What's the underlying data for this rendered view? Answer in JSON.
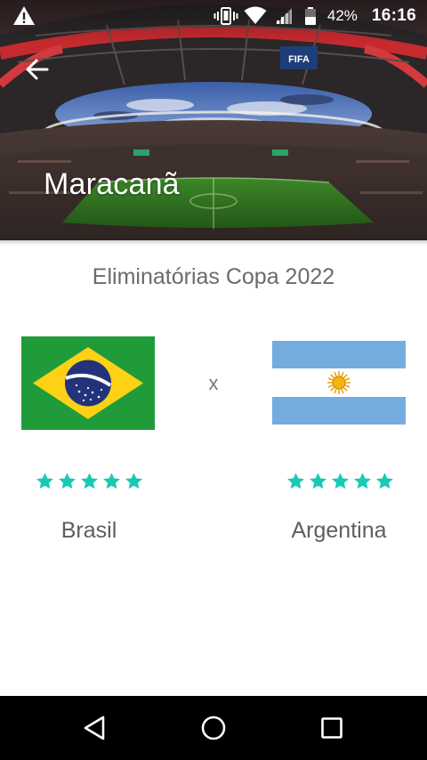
{
  "status_bar": {
    "battery_percent": "42%",
    "time": "16:16",
    "icons": [
      "warning-icon",
      "vibrate-icon",
      "wifi-icon",
      "signal-icon",
      "battery-icon"
    ]
  },
  "header": {
    "title": "Maracanã",
    "back_icon": "arrow-left-icon"
  },
  "match": {
    "competition": "Eliminatórias Copa 2022",
    "versus": "x",
    "home": {
      "name": "Brasil",
      "flag": "brazil-flag",
      "rating": 5,
      "rating_max": 5
    },
    "away": {
      "name": "Argentina",
      "flag": "argentina-flag",
      "rating": 5,
      "rating_max": 5
    }
  },
  "colors": {
    "star": "#19c9b4",
    "title": "#ffffff",
    "text_secondary": "#6b6b6b",
    "nav_bar": "#000000"
  },
  "nav_bar": {
    "buttons": [
      "nav-back-icon",
      "nav-home-icon",
      "nav-recents-icon"
    ]
  }
}
